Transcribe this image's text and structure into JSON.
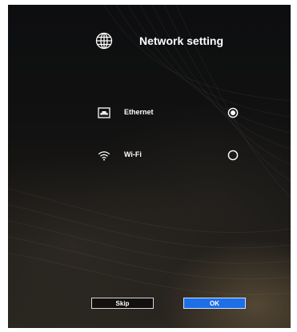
{
  "header": {
    "title": "Network setting",
    "icon": "globe-icon"
  },
  "options": [
    {
      "label": "Ethernet",
      "icon": "ethernet-icon",
      "selected": true
    },
    {
      "label": "Wi-Fi",
      "icon": "wifi-icon",
      "selected": false
    }
  ],
  "footer": {
    "skip_label": "Skip",
    "ok_label": "OK"
  },
  "colors": {
    "background": "#111111",
    "text": "#ffffff",
    "accent": "#1e6ee6",
    "radio": "#ffffff"
  }
}
